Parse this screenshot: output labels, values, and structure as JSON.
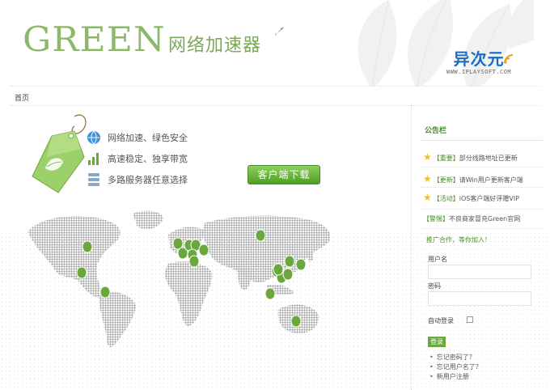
{
  "header": {
    "logo_word": "GREEN",
    "logo_sub": "网络加速器",
    "brand_cn": "异次元",
    "brand_en": "WWW.IPLAYSOFT.COM"
  },
  "breadcrumb": {
    "home": "首页"
  },
  "features": [
    {
      "icon": "globe-icon",
      "text": "网络加速、绿色安全"
    },
    {
      "icon": "signal-bars-icon",
      "text": "高速稳定、独享带宽"
    },
    {
      "icon": "server-stack-icon",
      "text": "多路服务器任意选择"
    }
  ],
  "download_button": "客户端下载",
  "map": {
    "pins": 19,
    "colors": {
      "pin": "#6aa83d",
      "land": "#9a9a9a"
    }
  },
  "sidebar": {
    "notice_title": "公告栏",
    "notices": [
      {
        "prefix": "【重要】",
        "text": "部分线路地址已更新",
        "starred": true
      },
      {
        "prefix": "【更新】",
        "text": "请Win用户更新客户端",
        "starred": true
      },
      {
        "prefix": "【活动】",
        "text": "iOS客户端好评赠VIP",
        "starred": true
      },
      {
        "prefix": "【警惕】",
        "text": "不良商家冒充Green官网",
        "starred": false
      }
    ],
    "promo": "推广合作，等你加入！",
    "username_label": "用户名",
    "password_label": "密码",
    "auto_login_label": "自动登录",
    "login_button": "登录",
    "links": [
      "忘记密码了？",
      "忘记用户名了？",
      "新用户注册"
    ]
  },
  "colors": {
    "brand_green": "#6aa83d",
    "logo_green": "#8bb86a",
    "brand_blue": "#1a6cc4",
    "star": "#f0c020"
  }
}
